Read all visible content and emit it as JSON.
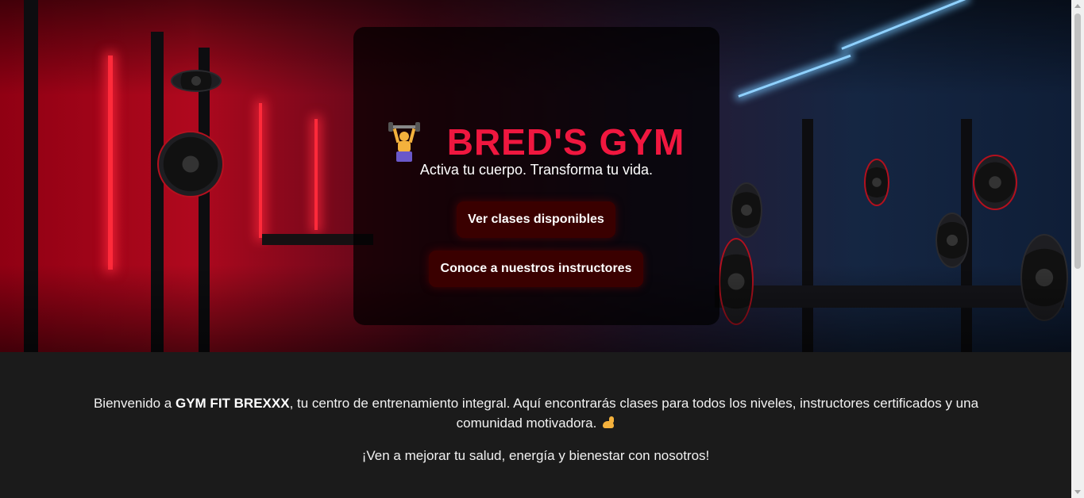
{
  "hero": {
    "title": "BRED'S GYM",
    "title_icon": "weightlifter-icon",
    "tagline": "Activa tu cuerpo. Transforma tu vida.",
    "buttons": {
      "classes": "Ver clases disponibles",
      "instructors": "Conoce a nuestros instructores"
    }
  },
  "content": {
    "intro_prefix": "Bienvenido a ",
    "intro_brand": "GYM FIT BREXXX",
    "intro_suffix": ", tu centro de entrenamiento integral. Aquí encontrarás clases para todos los niveles, instructores certificados y una comunidad motivadora.",
    "intro_icon": "flexed-biceps-icon",
    "cta": "¡Ven a mejorar tu salud, energía y bienestar con nosotros!"
  },
  "colors": {
    "title": "#f0173f",
    "button_bg": "#3a0000",
    "page_bg": "#1b1b1b"
  }
}
